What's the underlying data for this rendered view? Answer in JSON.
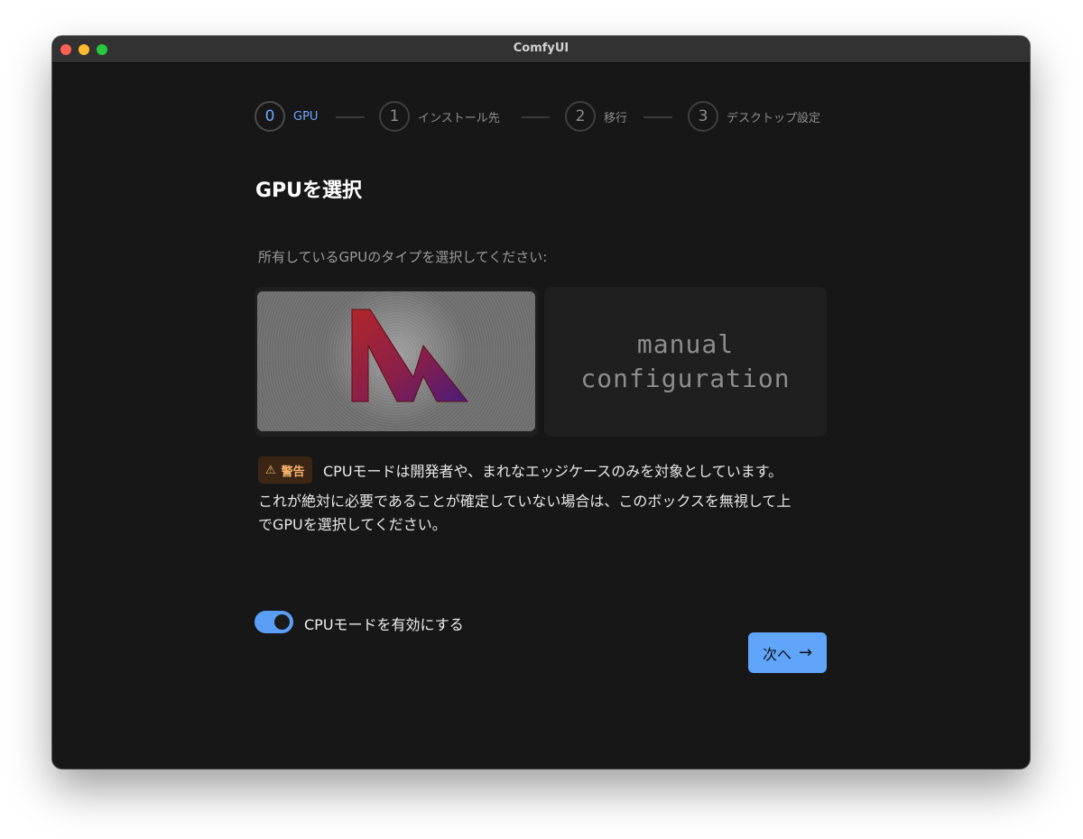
{
  "window": {
    "title": "ComfyUI"
  },
  "stepper": {
    "steps": [
      {
        "number": "0",
        "label": "GPU",
        "active": true
      },
      {
        "number": "1",
        "label": "インストール先",
        "active": false
      },
      {
        "number": "2",
        "label": "移行",
        "active": false
      },
      {
        "number": "3",
        "label": "デスクトップ設定",
        "active": false
      }
    ]
  },
  "main": {
    "title": "GPUを選択",
    "subtitle": "所有しているGPUのタイプを選択してください:",
    "gpu_options": [
      {
        "name": "mps",
        "logo": "metal-logo"
      },
      {
        "name": "manual",
        "line1": "manual",
        "line2": "configuration"
      }
    ],
    "warning": {
      "badge_icon": "⚠",
      "badge_label": "警告",
      "line1": "CPUモードは開発者や、まれなエッジケースのみを対象としています。",
      "line2": "これが絶対に必要であることが確定していない場合は、このボックスを無視して上",
      "line3": "でGPUを選択してください。"
    },
    "cpu_toggle": {
      "label": "CPUモードを有効にする",
      "enabled": true
    },
    "next_button": {
      "label": "次へ",
      "icon": "arrow-right-icon"
    }
  },
  "colors": {
    "accent": "#60a5fa",
    "background": "#171717",
    "warning_bg": "#3b2616",
    "warning_text": "#f6b168"
  }
}
